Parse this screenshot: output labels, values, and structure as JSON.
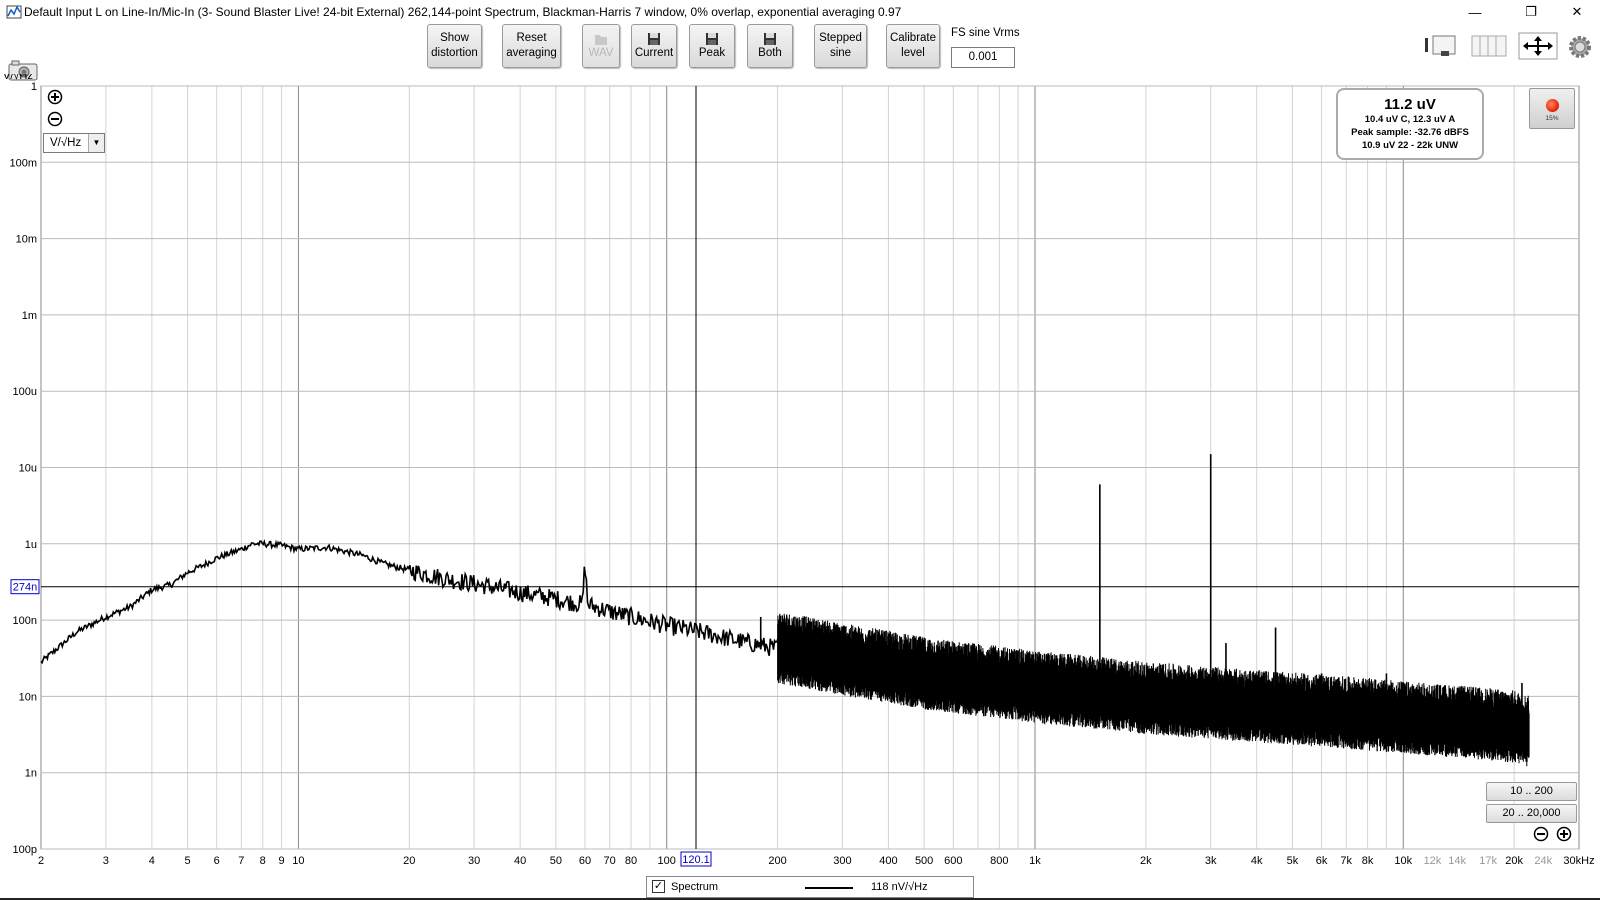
{
  "window": {
    "title": "Default Input L on Line-In/Mic-In (3- Sound Blaster Live! 24-bit External) 262,144-point Spectrum, Blackman-Harris 7 window, 0% overlap, exponential averaging 0.97",
    "minimize": "—",
    "restore": "❐",
    "close": "✕"
  },
  "toolbar": {
    "show_distortion": [
      "Show",
      "distortion"
    ],
    "reset_averaging": [
      "Reset",
      "averaging"
    ],
    "wav": "WAV",
    "current": "Current",
    "peak": "Peak",
    "both": "Both",
    "stepped_sine": [
      "Stepped",
      "sine"
    ],
    "calibrate_level": [
      "Calibrate",
      "level"
    ],
    "fs_sine_label": "FS sine Vrms",
    "fs_sine_value": "0.001"
  },
  "plot": {
    "y_unit_label": "V/√Hz",
    "y_unit_select": "V/√Hz",
    "cursor_y_label": "274n",
    "cursor_x_label": "120.1"
  },
  "readout": {
    "main": "11.2 uV",
    "line1": "10.4 uV C, 12.3 uV A",
    "line2": "Peak sample: -32.76 dBFS",
    "line3": "10.9 uV 22 - 22k UNW"
  },
  "record": {
    "percent": "15%"
  },
  "range_buttons": {
    "r1": "10 .. 200",
    "r2": "20 .. 20,000"
  },
  "legend": {
    "checked": "✓",
    "name": "Spectrum",
    "value": "118 nV/√Hz"
  },
  "colors": {
    "trace": "#000000",
    "grid": "#d0d0d0",
    "cursor_label": "#0000cc",
    "record_led": "#e02000"
  },
  "chart_data": {
    "type": "line",
    "xscale": "log",
    "yscale": "log",
    "xlim": [
      2,
      30000
    ],
    "ylim": [
      1e-10,
      1
    ],
    "x_tick_labels": [
      "2",
      "3",
      "4",
      "5",
      "6",
      "7",
      "8",
      "9",
      "10",
      "20",
      "30",
      "40",
      "50",
      "60",
      "70",
      "80",
      "100",
      "200",
      "300",
      "400",
      "500",
      "600",
      "800",
      "1k",
      "2k",
      "3k",
      "4k",
      "5k",
      "6k",
      "7k",
      "8k",
      "10k",
      "12k",
      "14k",
      "17k",
      "20k",
      "24k",
      "30kHz"
    ],
    "y_tick_labels": [
      "1",
      "100m",
      "10m",
      "1m",
      "100u",
      "10u",
      "1u",
      "100n",
      "10n",
      "1n",
      "100p"
    ],
    "series": [
      {
        "x": [
          2,
          2.5,
          3,
          3.5,
          4,
          4.5,
          5,
          5.5,
          6,
          7,
          7.5,
          8,
          9,
          10,
          12,
          15,
          17,
          20,
          25,
          30,
          40,
          50,
          59,
          60,
          61,
          70,
          80,
          100,
          120,
          150,
          200,
          250,
          300,
          400,
          500,
          600,
          800,
          1000,
          1500,
          2000,
          3000,
          4000,
          5000,
          7000,
          10000,
          15000,
          20000,
          22000
        ],
        "y": [
          2.8e-08,
          7e-08,
          1.1e-07,
          1.5e-07,
          2.5e-07,
          2.9e-07,
          4.2e-07,
          5.2e-07,
          6.5e-07,
          8.5e-07,
          1e-06,
          1e-06,
          9.5e-07,
          8.5e-07,
          9e-07,
          7e-07,
          5.5e-07,
          4.5e-07,
          3.5e-07,
          3e-07,
          2.3e-07,
          1.9e-07,
          1.6e-07,
          5.8e-07,
          1.6e-07,
          1.3e-07,
          1.1e-07,
          8.5e-08,
          7.2e-08,
          5.6e-08,
          4.2e-08,
          3.4e-08,
          2.9e-08,
          2.3e-08,
          1.9e-08,
          1.7e-08,
          1.45e-08,
          1.25e-08,
          1.05e-08,
          9e-09,
          7.8e-09,
          7e-09,
          6.5e-09,
          5.8e-09,
          5e-09,
          4.3e-09,
          3.8e-09,
          3.2e-09
        ]
      }
    ],
    "spikes": [
      {
        "x": 60,
        "y": 5.8e-07
      },
      {
        "x": 180,
        "y": 1.1e-07
      },
      {
        "x": 300,
        "y": 7e-08
      },
      {
        "x": 420,
        "y": 5e-08
      },
      {
        "x": 900,
        "y": 4e-08
      },
      {
        "x": 1500,
        "y": 6e-06
      },
      {
        "x": 3000,
        "y": 1.5e-05
      },
      {
        "x": 3300,
        "y": 5e-08
      },
      {
        "x": 4500,
        "y": 8e-08
      },
      {
        "x": 6000,
        "y": 2e-08
      },
      {
        "x": 9000,
        "y": 2e-08
      },
      {
        "x": 21000,
        "y": 1.5e-08
      }
    ],
    "cursor": {
      "x": 120.1,
      "y": 2.74e-07
    }
  }
}
